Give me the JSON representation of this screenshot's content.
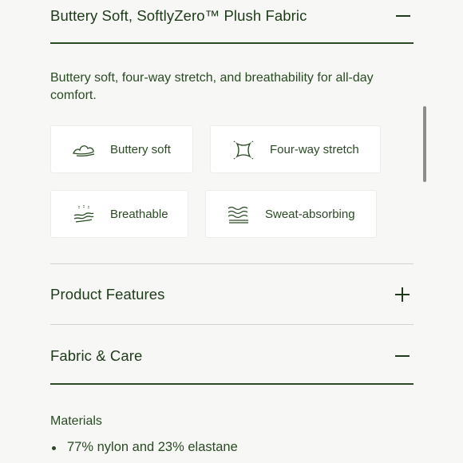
{
  "sections": {
    "fabric_feature": {
      "title": "Buttery Soft, SoftlyZero™ Plush Fabric",
      "toggle_icon": "minus-icon",
      "description": "Buttery soft, four-way stretch, and breathability for all-day comfort.",
      "chips": [
        {
          "label": "Buttery soft",
          "icon": "cloud-icon"
        },
        {
          "label": "Four-way stretch",
          "icon": "stretch-icon"
        },
        {
          "label": "Breathable",
          "icon": "breathable-icon"
        },
        {
          "label": "Sweat-absorbing",
          "icon": "waves-icon"
        }
      ]
    },
    "product_features": {
      "title": "Product Features",
      "toggle_icon": "plus-icon"
    },
    "fabric_care": {
      "title": "Fabric & Care",
      "toggle_icon": "minus-icon",
      "materials_heading": "Materials",
      "materials": [
        "77% nylon and 23% elastane"
      ]
    }
  },
  "colors": {
    "accent": "#1e3a1a",
    "background": "#f7f7f5",
    "chip_background": "#ffffff"
  }
}
